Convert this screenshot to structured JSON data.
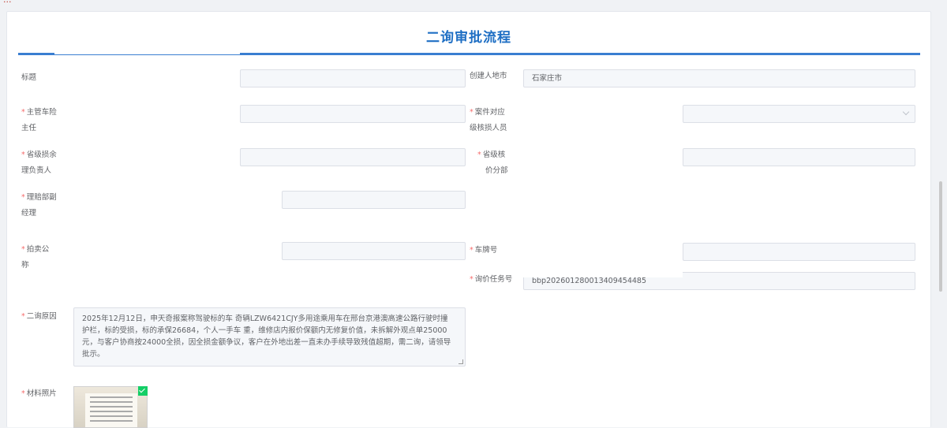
{
  "page": {
    "title": "二询审批流程"
  },
  "fields": {
    "title": {
      "label": "标题",
      "value": ""
    },
    "creator_city": {
      "label": "创建人地市",
      "value": "石家庄市"
    },
    "vehicle_supervisor": {
      "label_line1": "主管车险",
      "label_line2": "主任",
      "value": ""
    },
    "case_reviewer": {
      "label_line1": "案件对应",
      "label_line2": "级核损人员",
      "value": ""
    },
    "provincial_loss_head": {
      "label_line1": "省级损余",
      "label_line2": "理负责人",
      "value": ""
    },
    "provincial_price_dept": {
      "label_line1": "省级核",
      "label_line2": "价分部",
      "value": ""
    },
    "claims_manager": {
      "label_line1": "理赔部副",
      "label_line2": "经理",
      "value": ""
    },
    "auction_company": {
      "label_line1": "拍卖公",
      "label_line2": "称",
      "value": ""
    },
    "plate_number": {
      "label": "车牌号",
      "value": ""
    },
    "inquiry_task_no": {
      "label": "询价任务号",
      "value": "bbp202601280013409454485"
    },
    "reason": {
      "label": "二询原因",
      "line1": "2025年12月12日，申天奇报案称驾驶标的车​      奇辆LZW6421CJY多用途乘用车在邢台京港澳高速公路行驶时撞",
      "line2": "护栏，标的受损，标的承保26684，个人一手车      重，维修店内报价保额内无修复价值，未拆解外观点单25000",
      "line3": "元，与客户协商按24000全损，因全损金额争议，客户在外地出差一直未办手续导致残值超期，需二询，请领导批示。"
    },
    "photos": {
      "label": "材料照片"
    }
  },
  "colors": {
    "accent": "#1f6fc4",
    "required": "#f56c6c",
    "success": "#13ce66"
  }
}
